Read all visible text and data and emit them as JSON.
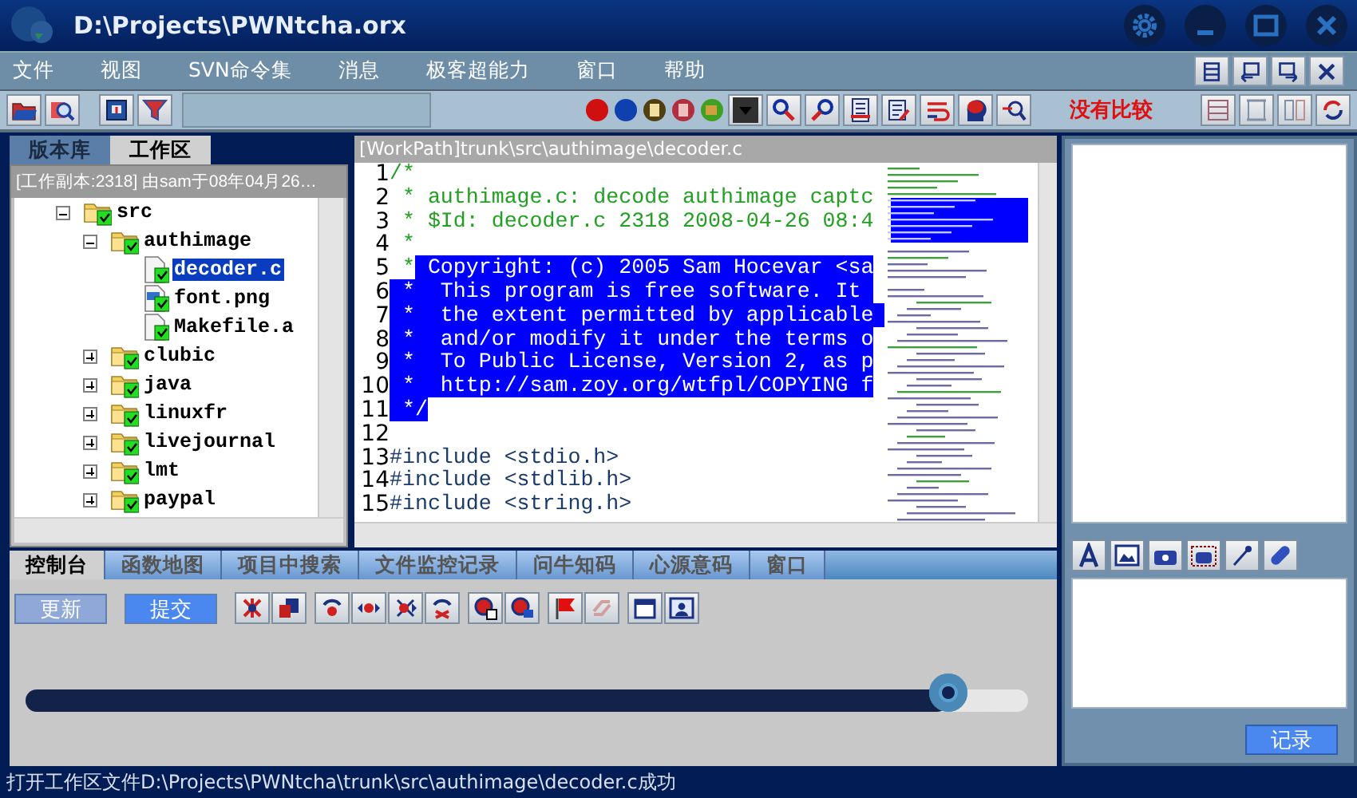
{
  "window": {
    "title": "D:\\Projects\\PWNtcha.orx"
  },
  "menu": [
    "文件",
    "视图",
    "SVN命令集",
    "消息",
    "极客超能力",
    "窗口",
    "帮助"
  ],
  "toolbar": {
    "compare_status": "没有比较"
  },
  "left_panel": {
    "tabs": [
      {
        "label": "版本库",
        "selected": false
      },
      {
        "label": "工作区",
        "selected": true
      }
    ],
    "info": "[工作副本:2318] 由sam于08年04月26…",
    "tree": [
      {
        "label": "src",
        "kind": "folder",
        "expanded": true,
        "selected": false,
        "children": [
          {
            "label": "authimage",
            "kind": "folder",
            "expanded": true,
            "selected": false,
            "children": [
              {
                "label": "decoder.c",
                "kind": "file",
                "selected": true
              },
              {
                "label": "font.png",
                "kind": "image",
                "selected": false
              },
              {
                "label": "Makefile.a",
                "kind": "file",
                "selected": false
              }
            ]
          },
          {
            "label": "clubic",
            "kind": "folder",
            "expanded": false,
            "selected": false
          },
          {
            "label": "java",
            "kind": "folder",
            "expanded": false,
            "selected": false
          },
          {
            "label": "linuxfr",
            "kind": "folder",
            "expanded": false,
            "selected": false
          },
          {
            "label": "livejournal",
            "kind": "folder",
            "expanded": false,
            "selected": false
          },
          {
            "label": "lmt",
            "kind": "folder",
            "expanded": false,
            "selected": false
          },
          {
            "label": "paypal",
            "kind": "folder",
            "expanded": false,
            "selected": false
          }
        ]
      }
    ]
  },
  "editor": {
    "path": "[WorkPath]trunk\\src\\authimage\\decoder.c",
    "lines": [
      {
        "number": "1",
        "kind": "comment",
        "segments": [
          {
            "text": "/*",
            "selected": false
          }
        ]
      },
      {
        "number": "2",
        "kind": "comment",
        "segments": [
          {
            "text": " * authimage.c: decode authimage captc",
            "selected": false
          }
        ]
      },
      {
        "number": "3",
        "kind": "comment",
        "segments": [
          {
            "text": " * $Id: decoder.c 2318 2008-04-26 08:4",
            "selected": false
          }
        ]
      },
      {
        "number": "4",
        "kind": "comment",
        "segments": [
          {
            "text": " *",
            "selected": false
          }
        ]
      },
      {
        "number": "5",
        "kind": "comment",
        "segments": [
          {
            "text": " *",
            "selected": false
          },
          {
            "text": " Copyright: (c) 2005 Sam Hocevar <sa",
            "selected": true
          }
        ]
      },
      {
        "number": "6",
        "kind": "comment",
        "segments": [
          {
            "text": " *  This program is free software. It ",
            "selected": true
          }
        ]
      },
      {
        "number": "7",
        "kind": "comment",
        "segments": [
          {
            "text": " *  the extent permitted by applicable ",
            "selected": true
          }
        ]
      },
      {
        "number": "8",
        "kind": "comment",
        "segments": [
          {
            "text": " *  and/or modify it under the terms o",
            "selected": true
          }
        ]
      },
      {
        "number": "9",
        "kind": "comment",
        "segments": [
          {
            "text": " *  To Public License, Version 2, as p",
            "selected": true
          }
        ]
      },
      {
        "number": "10",
        "kind": "comment",
        "segments": [
          {
            "text": " *  http://sam.zoy.org/wtfpl/COPYING f",
            "selected": true
          }
        ]
      },
      {
        "number": "11",
        "kind": "comment",
        "segments": [
          {
            "text": " */",
            "selected": true
          }
        ]
      },
      {
        "number": "12"
      },
      {
        "number": "13",
        "kind": "code",
        "segments": [
          {
            "text": "#include <stdio.h>",
            "selected": false
          }
        ]
      },
      {
        "number": "14",
        "kind": "code",
        "segments": [
          {
            "text": "#include <stdlib.h>",
            "selected": false
          }
        ]
      },
      {
        "number": "15",
        "kind": "code",
        "segments": [
          {
            "text": "#include <string.h>",
            "selected": false
          }
        ]
      }
    ]
  },
  "bottom_panel": {
    "tabs": [
      {
        "label": "控制台",
        "selected": true
      },
      {
        "label": "函数地图",
        "selected": false
      },
      {
        "label": "项目中搜索",
        "selected": false
      },
      {
        "label": "文件监控记录",
        "selected": false
      },
      {
        "label": "问牛知码",
        "selected": false
      },
      {
        "label": "心源意码",
        "selected": false
      },
      {
        "label": "窗口",
        "selected": false
      }
    ],
    "buttons": [
      {
        "label": "更新",
        "disabled": true
      },
      {
        "label": "提交",
        "disabled": false
      }
    ],
    "slider": {
      "level": 0.92
    }
  },
  "right_panel": {
    "log_button": "记录"
  },
  "status_bar": "打开工作区文件D:\\Projects\\PWNtcha\\trunk\\src\\authimage\\decoder.c成功"
}
